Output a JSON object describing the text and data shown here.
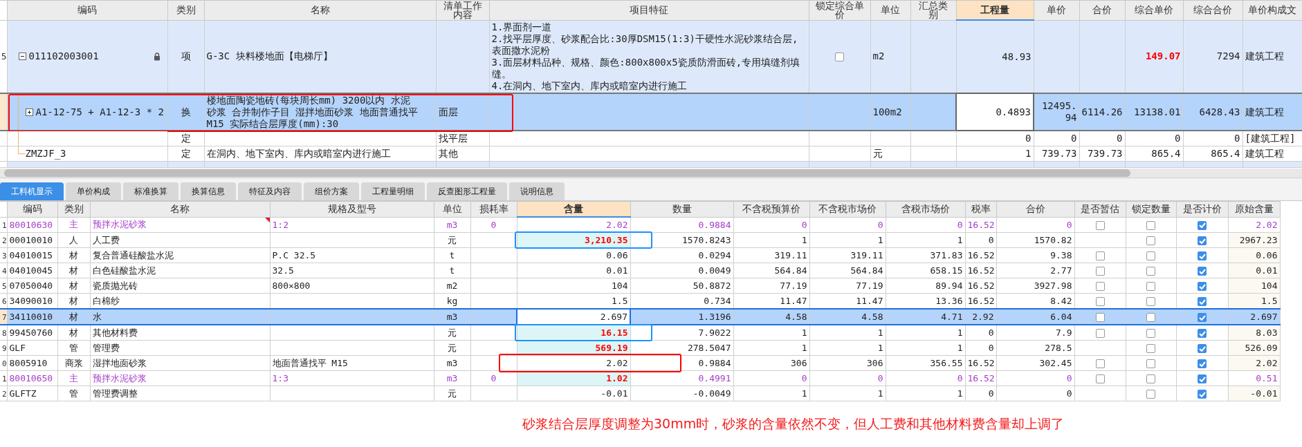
{
  "bill_table": {
    "columns": [
      {
        "label": "编码",
        "selected": false
      },
      {
        "label": "类别",
        "selected": false
      },
      {
        "label": "名称",
        "selected": false
      },
      {
        "label": "清单工作内容",
        "selected": false
      },
      {
        "label": "项目特征",
        "selected": false
      },
      {
        "label": "锁定综合单价",
        "selected": false
      },
      {
        "label": "单位",
        "selected": false
      },
      {
        "label": "汇总类别",
        "selected": false
      },
      {
        "label": "工程量",
        "selected": true
      },
      {
        "label": "单价",
        "selected": false
      },
      {
        "label": "合价",
        "selected": false
      },
      {
        "label": "综合单价",
        "selected": false
      },
      {
        "label": "综合合价",
        "selected": false
      },
      {
        "label": "单价构成文",
        "selected": false
      }
    ],
    "rows": [
      {
        "index": "5",
        "code": "011102003001",
        "locked": true,
        "expanded": true,
        "selected": false,
        "type": "项",
        "name": "G-3C 块料楼地面【电梯厅】",
        "features": "1.界面剂一道\n2.找平层厚度、砂浆配合比:30厚DSM15(1:3)干硬性水泥砂浆结合层,表面撒水泥粉\n3.面层材料品种、规格、颜色:800x800x5瓷质防滑面砖,专用填缝剂填缝。\n4.在洞内、地下室内、库内或暗室内进行施工",
        "lock_price": false,
        "unit": "m2",
        "qty": "48.93",
        "comp_price": "149.07",
        "price_alert": true,
        "comp_total": "7294",
        "file": "建筑工程",
        "children": [
          {
            "code": "A1-12-75 + A1-12-3 * 2",
            "expanded": false,
            "selected": true,
            "callout": {
              "color": "#ff0000"
            },
            "type": "换",
            "name": "楼地面陶瓷地砖(每块周长mm) 3200以内 水泥砂浆  合并制作子目 湿拌地面砂浆 地面普通找平M15  实际结合层厚度(mm):30",
            "work": "面层",
            "unit": "100m2",
            "qty": "0.4893",
            "price": "12495.94",
            "total": "6114.26",
            "comp_price": "13138.01",
            "comp_total": "6428.43",
            "file": "建筑工程"
          },
          {
            "selected": false,
            "type": "定",
            "work": "找平层",
            "qty": "0",
            "price": "0",
            "total": "0",
            "comp_price": "0",
            "comp_total": "0",
            "file": "[建筑工程]"
          },
          {
            "code": "ZMZJF_3",
            "selected": false,
            "type": "定",
            "name": "在洞内、地下室内、库内或暗室内进行施工",
            "work": "其他",
            "unit": "元",
            "qty": "1",
            "price": "739.73",
            "total": "739.73",
            "comp_price": "865.4",
            "comp_total": "865.4",
            "file": "建筑工程"
          }
        ]
      }
    ]
  },
  "tabs": [
    {
      "label": "工料机显示",
      "selected": true
    },
    {
      "label": "单价构成",
      "selected": false
    },
    {
      "label": "标准换算",
      "selected": false
    },
    {
      "label": "换算信息",
      "selected": false
    },
    {
      "label": "特征及内容",
      "selected": false
    },
    {
      "label": "组价方案",
      "selected": false
    },
    {
      "label": "工程量明细",
      "selected": false
    },
    {
      "label": "反查图形工程量",
      "selected": false
    },
    {
      "label": "说明信息",
      "selected": false
    }
  ],
  "resource_table": {
    "columns": [
      {
        "label": "编码",
        "selected": false
      },
      {
        "label": "类别",
        "selected": false
      },
      {
        "label": "名称",
        "selected": false
      },
      {
        "label": "规格及型号",
        "selected": false
      },
      {
        "label": "单位",
        "selected": false
      },
      {
        "label": "损耗率",
        "selected": false
      },
      {
        "label": "含量",
        "selected": true
      },
      {
        "label": "数量",
        "selected": false
      },
      {
        "label": "不含税预算价",
        "selected": false
      },
      {
        "label": "不含税市场价",
        "selected": false
      },
      {
        "label": "含税市场价",
        "selected": false
      },
      {
        "label": "税率",
        "selected": false
      },
      {
        "label": "合价",
        "selected": false
      },
      {
        "label": "是否暂估",
        "selected": false
      },
      {
        "label": "锁定数量",
        "selected": false
      },
      {
        "label": "是否计价",
        "selected": false
      },
      {
        "label": "原始含量",
        "selected": false
      }
    ],
    "rows": [
      {
        "index": "1",
        "kind": "main",
        "selected": false,
        "comment": true,
        "code": "80010630",
        "type": "主",
        "name": "预拌水泥砂浆",
        "spec": "1:2",
        "unit": "m3",
        "loss": "0",
        "content": "2.02",
        "qty": "0.9884",
        "budget": "0",
        "market": "0",
        "tax_market": "0",
        "rate": "16.52",
        "total": "0",
        "estimated": false,
        "lock_qty": false,
        "priced": true,
        "original": "2.02"
      },
      {
        "index": "2",
        "kind": "normal",
        "selected": false,
        "changed": true,
        "callout": {
          "color": "#1e90ff"
        },
        "code": "00010010",
        "type": "人",
        "name": "人工费",
        "unit": "元",
        "content": "3,210.35",
        "qty": "1570.8243",
        "budget": "1",
        "market": "1",
        "tax_market": "1",
        "rate": "0",
        "total": "1570.82",
        "lock_qty": false,
        "priced": true,
        "original": "2967.23"
      },
      {
        "index": "3",
        "kind": "normal",
        "selected": false,
        "code": "04010015",
        "type": "材",
        "name": "复合普通硅酸盐水泥",
        "spec": "P.C 32.5",
        "unit": "t",
        "content": "0.06",
        "qty": "0.0294",
        "budget": "319.11",
        "market": "319.11",
        "tax_market": "371.83",
        "rate": "16.52",
        "total": "9.38",
        "estimated": false,
        "lock_qty": false,
        "priced": true,
        "original": "0.06"
      },
      {
        "index": "4",
        "kind": "normal",
        "selected": false,
        "code": "04010045",
        "type": "材",
        "name": "白色硅酸盐水泥",
        "spec": "32.5",
        "unit": "t",
        "content": "0.01",
        "qty": "0.0049",
        "budget": "564.84",
        "market": "564.84",
        "tax_market": "658.15",
        "rate": "16.52",
        "total": "2.77",
        "estimated": false,
        "lock_qty": false,
        "priced": true,
        "original": "0.01"
      },
      {
        "index": "5",
        "kind": "normal",
        "selected": false,
        "code": "07050040",
        "type": "材",
        "name": "瓷质抛光砖",
        "spec": "800×800",
        "unit": "m2",
        "content": "104",
        "qty": "50.8872",
        "budget": "77.19",
        "market": "77.19",
        "tax_market": "89.94",
        "rate": "16.52",
        "total": "3927.98",
        "estimated": false,
        "lock_qty": false,
        "priced": true,
        "original": "104"
      },
      {
        "index": "6",
        "kind": "normal",
        "selected": false,
        "code": "34090010",
        "type": "材",
        "name": "白棉纱",
        "unit": "kg",
        "content": "1.5",
        "qty": "0.734",
        "budget": "11.47",
        "market": "11.47",
        "tax_market": "13.36",
        "rate": "16.52",
        "total": "8.42",
        "estimated": false,
        "lock_qty": false,
        "priced": true,
        "original": "1.5"
      },
      {
        "index": "7",
        "kind": "normal",
        "selected": true,
        "code": "34110010",
        "type": "材",
        "name": "水",
        "unit": "m3",
        "content": "2.697",
        "qty": "1.3196",
        "budget": "4.58",
        "market": "4.58",
        "tax_market": "4.71",
        "rate": "2.92",
        "total": "6.04",
        "estimated": false,
        "lock_qty": false,
        "priced": true,
        "original": "2.697"
      },
      {
        "index": "8",
        "kind": "normal",
        "selected": false,
        "changed": true,
        "callout": {
          "color": "#1e90ff"
        },
        "code": "99450760",
        "type": "材",
        "name": "其他材料费",
        "unit": "元",
        "content": "16.15",
        "qty": "7.9022",
        "budget": "1",
        "market": "1",
        "tax_market": "1",
        "rate": "0",
        "total": "7.9",
        "estimated": false,
        "lock_qty": false,
        "priced": true,
        "original": "8.03"
      },
      {
        "index": "9",
        "kind": "normal",
        "selected": false,
        "changed": true,
        "code": "GLF",
        "type": "管",
        "name": "管理费",
        "unit": "元",
        "content": "569.19",
        "qty": "278.5047",
        "budget": "1",
        "market": "1",
        "tax_market": "1",
        "rate": "0",
        "total": "278.5",
        "lock_qty": false,
        "priced": true,
        "original": "526.09"
      },
      {
        "index": "0",
        "kind": "normal",
        "selected": false,
        "callout": {
          "color": "#ff0000"
        },
        "code": "8005910",
        "type": "商浆",
        "name": "湿拌地面砂浆",
        "spec": "地面普通找平 M15",
        "unit": "m3",
        "content": "2.02",
        "qty": "0.9884",
        "budget": "306",
        "market": "306",
        "tax_market": "356.55",
        "rate": "16.52",
        "total": "302.45",
        "estimated": false,
        "lock_qty": false,
        "priced": true,
        "original": "2.02"
      },
      {
        "index": "1",
        "kind": "main",
        "selected": false,
        "changed": true,
        "code": "80010650",
        "type": "主",
        "name": "预拌水泥砂浆",
        "spec": "1:3",
        "unit": "m3",
        "loss": "0",
        "content": "1.02",
        "qty": "0.4991",
        "budget": "0",
        "market": "0",
        "tax_market": "0",
        "rate": "16.52",
        "total": "0",
        "estimated": false,
        "lock_qty": false,
        "priced": true,
        "original": "0.51"
      },
      {
        "index": "2",
        "kind": "normal",
        "selected": false,
        "code": "GLFTZ",
        "type": "管",
        "name": "管理费调整",
        "unit": "元",
        "content": "-0.01",
        "qty": "-0.0049",
        "budget": "1",
        "market": "1",
        "tax_market": "1",
        "rate": "0",
        "total": "0",
        "lock_qty": false,
        "priced": true,
        "original": "-0.01"
      }
    ]
  },
  "note": "砂浆结合层厚度调整为30mm时，砂浆的含量依然不变，但人工费和其他材料费含量却上调了"
}
